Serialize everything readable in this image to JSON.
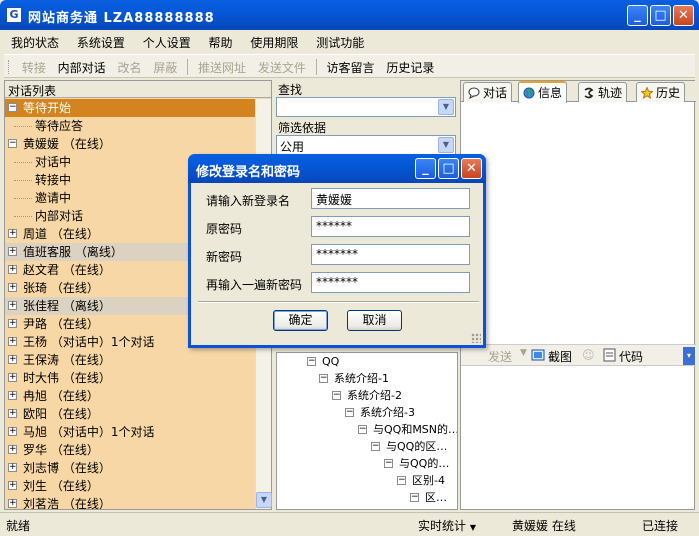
{
  "window": {
    "title": "网站商务通  LZA88888888",
    "app_icon": "G",
    "min_glyph": "_",
    "max_glyph": "□",
    "close_glyph": "✕"
  },
  "menu": [
    "我的状态",
    "系统设置",
    "个人设置",
    "帮助",
    "使用期限",
    "测试功能"
  ],
  "toolbar": {
    "transfer": "转接",
    "internal_chat": "内部对话",
    "rename": "改名",
    "block": "屏蔽",
    "push_url": "推送网址",
    "send_file": "发送文件",
    "visitor_message": "访客留言",
    "history": "历史记录"
  },
  "left_panel": {
    "header": "对话列表",
    "rows": [
      {
        "text": "等待开始",
        "toggle": "−"
      },
      {
        "text": "等待应答"
      },
      {
        "text": "黄媛媛 （在线）",
        "toggle": "−"
      },
      {
        "text": "对话中"
      },
      {
        "text": "转接中"
      },
      {
        "text": "邀请中"
      },
      {
        "text": "内部对话"
      },
      {
        "text": "周道 （在线）",
        "toggle": "+"
      },
      {
        "text": "值班客服 （离线）",
        "toggle": "+"
      },
      {
        "text": "赵文君 （在线）",
        "toggle": "+"
      },
      {
        "text": "张琦 （在线）",
        "toggle": "+"
      },
      {
        "text": "张佳程 （离线）",
        "toggle": "+"
      },
      {
        "text": "尹路 （在线）",
        "toggle": "+"
      },
      {
        "text": "王杨 （对话中）1个对话",
        "toggle": "+"
      },
      {
        "text": "王保涛 （在线）",
        "toggle": "+"
      },
      {
        "text": "时大伟 （在线）",
        "toggle": "+"
      },
      {
        "text": "冉旭 （在线）",
        "toggle": "+"
      },
      {
        "text": "欧阳 （在线）",
        "toggle": "+"
      },
      {
        "text": "马旭 （对话中）1个对话",
        "toggle": "+"
      },
      {
        "text": "罗华 （在线）",
        "toggle": "+"
      },
      {
        "text": "刘志博 （在线）",
        "toggle": "+"
      },
      {
        "text": "刘生 （在线）",
        "toggle": "+"
      },
      {
        "text": "刘茗浩 （在线）",
        "toggle": "+"
      }
    ]
  },
  "mid_panel": {
    "search_label": "查找",
    "search_value": "",
    "filter_label": "筛选依据",
    "filter_value": "公用",
    "tree": [
      {
        "text": "QQ",
        "toggle": "−"
      },
      {
        "text": "系统介绍-1",
        "toggle": "−"
      },
      {
        "text": "系统介绍-2",
        "toggle": "−"
      },
      {
        "text": "系统介绍-3",
        "toggle": "−"
      },
      {
        "text": "与QQ和MSN的…",
        "toggle": "−"
      },
      {
        "text": "与QQ的区…",
        "toggle": "−"
      },
      {
        "text": "与QQ的…",
        "toggle": "−"
      },
      {
        "text": "区别-4",
        "toggle": "−"
      },
      {
        "text": "区…",
        "toggle": "−"
      }
    ]
  },
  "right_panel": {
    "tabs": [
      "对话",
      "信息",
      "轨迹",
      "历史"
    ],
    "active_tab": 1,
    "send": "发送",
    "screenshot": "截图",
    "code": "代码"
  },
  "status": {
    "left": "就绪",
    "stats": "实时统计",
    "user": "黄媛媛 在线",
    "connection": "已连接"
  },
  "dialog": {
    "title": "修改登录名和密码",
    "new_login_label": "请输入新登录名",
    "new_login_value": "黄媛媛",
    "old_pwd_label": "原密码",
    "old_pwd_value": "******",
    "new_pwd_label": "新密码",
    "new_pwd_value": "*******",
    "confirm_pwd_label": "再输入一遍新密码",
    "confirm_pwd_value": "*******",
    "ok": "确定",
    "cancel": "取消"
  },
  "colors": {
    "titlebar": "#0558d8",
    "left_panel_bg": "#f7d7a6",
    "selected_row": "#d4841e",
    "offline_row": "#dcd2c1"
  }
}
